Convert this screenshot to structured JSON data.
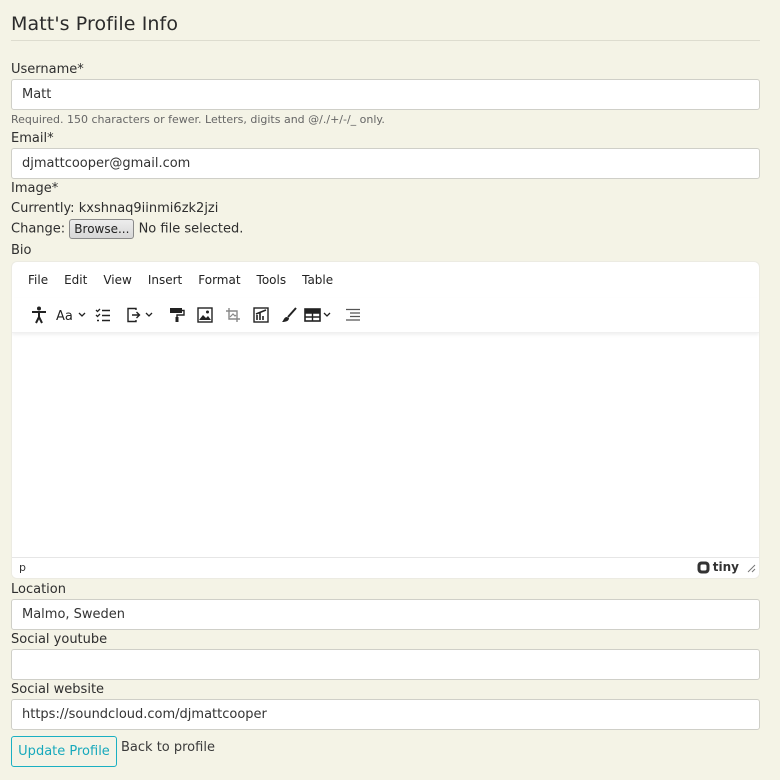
{
  "page": {
    "title": "Matt's Profile Info"
  },
  "form": {
    "username": {
      "label": "Username*",
      "value": "Matt",
      "help": "Required. 150 characters or fewer. Letters, digits and @/./+/-/_ only."
    },
    "email": {
      "label": "Email*",
      "value": "djmattcooper@gmail.com"
    },
    "image": {
      "label": "Image*",
      "currently_label": "Currently:",
      "currently_value": "kxshnaq9iinmi6zk2jzi",
      "change_label": "Change:",
      "browse_label": "Browse...",
      "file_status": "No file selected."
    },
    "bio": {
      "label": "Bio",
      "menu": [
        "File",
        "Edit",
        "View",
        "Insert",
        "Format",
        "Tools",
        "Table"
      ],
      "status_path": "p",
      "brand": "tiny"
    },
    "location": {
      "label": "Location",
      "value": "Malmo, Sweden"
    },
    "social_youtube": {
      "label": "Social youtube",
      "value": ""
    },
    "social_website": {
      "label": "Social website",
      "value": "https://soundcloud.com/djmattcooper"
    }
  },
  "actions": {
    "update_label": "Update Profile",
    "back_label": "Back to profile"
  },
  "colors": {
    "background": "#f4f3e6",
    "accent": "#17a9bc"
  },
  "toolbar_icons": [
    "accessibility-icon",
    "font-size-icon",
    "checklist-icon",
    "export-icon",
    "format-painter-icon",
    "image-icon",
    "crop-icon",
    "chart-image-icon",
    "brush-icon",
    "table-icon",
    "list-icon"
  ]
}
